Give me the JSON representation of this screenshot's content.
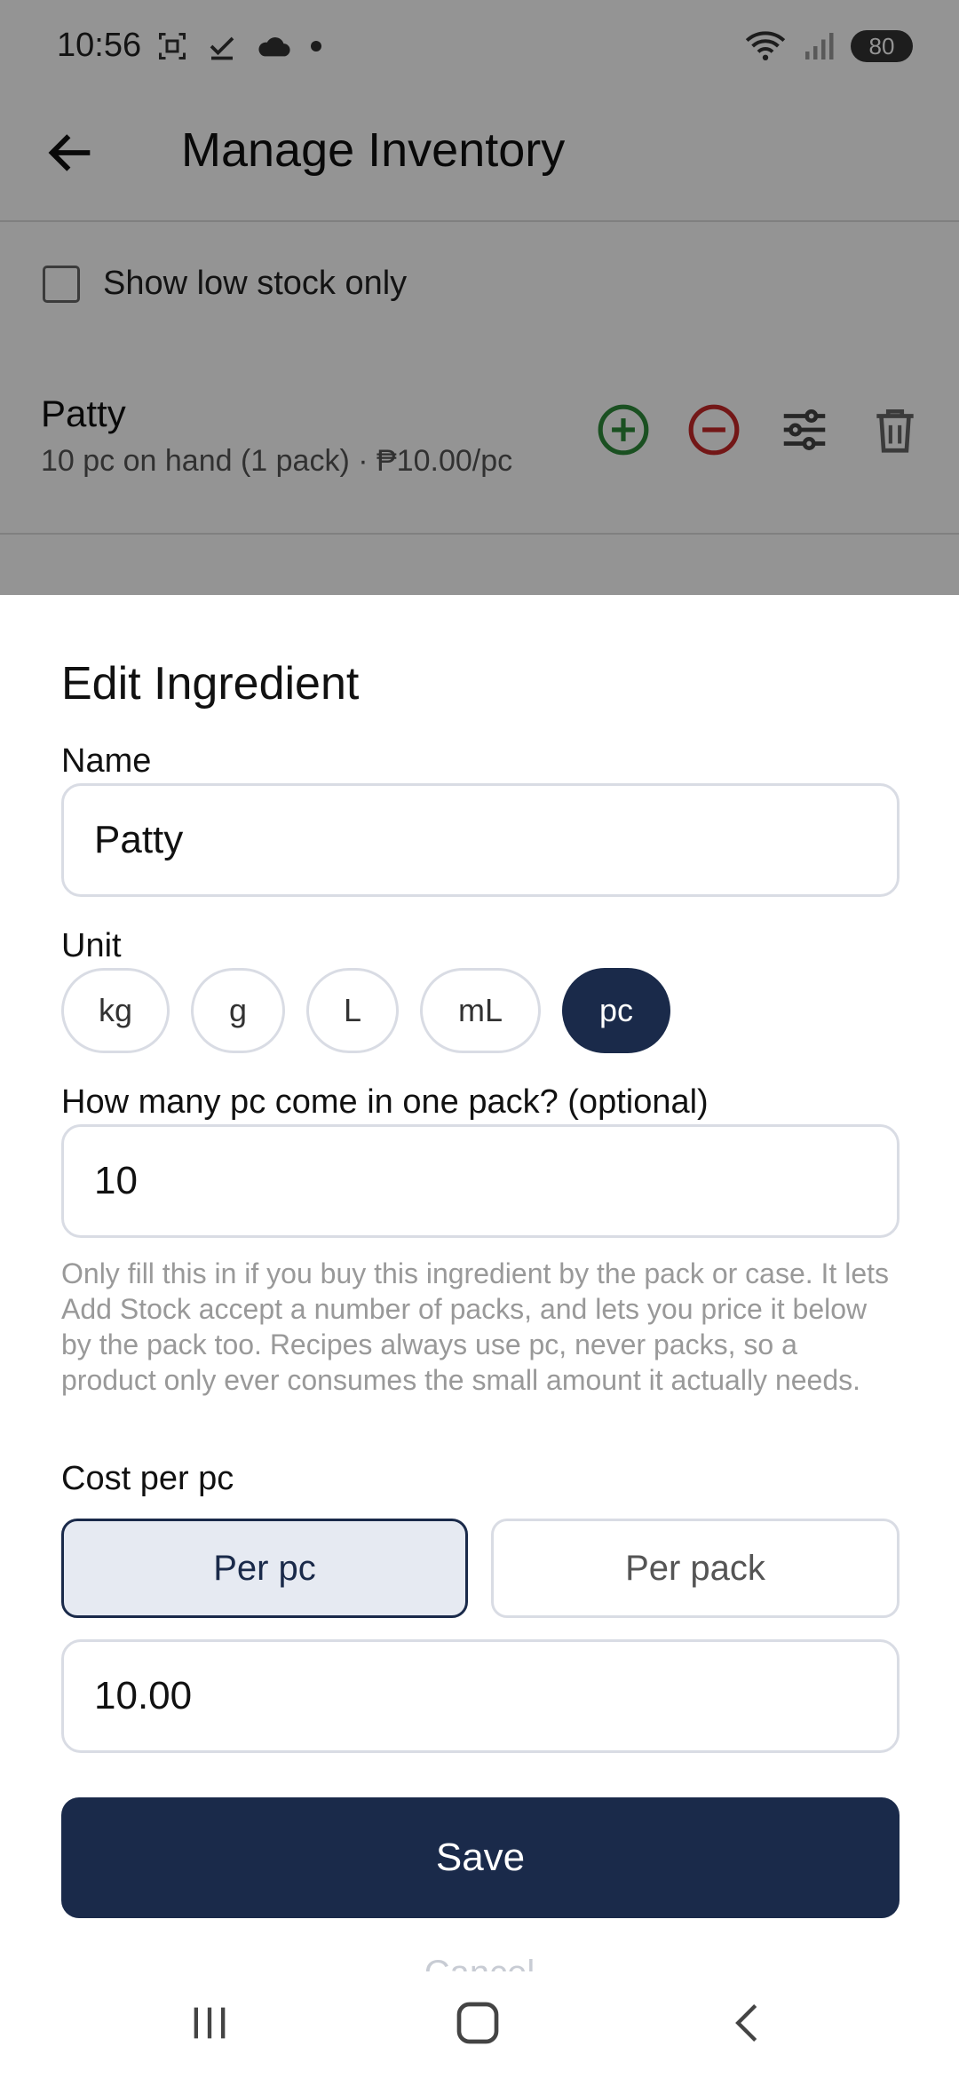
{
  "status_bar": {
    "time": "10:56",
    "battery": "80"
  },
  "app_bar": {
    "title": "Manage Inventory"
  },
  "filter": {
    "show_low_stock_label": "Show low stock only"
  },
  "inventory_item": {
    "name": "Patty",
    "meta": "10 pc on hand (1 pack) · ₱10.00/pc"
  },
  "sheet": {
    "title": "Edit Ingredient",
    "name_label": "Name",
    "name_value": "Patty",
    "unit_label": "Unit",
    "units": [
      "kg",
      "g",
      "L",
      "mL",
      "pc"
    ],
    "selected_unit": "pc",
    "pack_label": "How many pc come in one pack? (optional)",
    "pack_value": "10",
    "help_text": "Only fill this in if you buy this ingredient by the pack or case. It lets Add Stock accept a number of packs, and lets you price it below by the pack too. Recipes always use pc, never packs, so a product only ever consumes the small amount it actually needs.",
    "cost_label": "Cost per pc",
    "cost_modes": [
      "Per pc",
      "Per pack"
    ],
    "cost_value": "10.00",
    "save_label": "Save",
    "cancel_label": "Cancel"
  },
  "colors": {
    "primary": "#1a2a4a",
    "add_green": "#2e8b3a",
    "remove_red": "#c62828"
  }
}
